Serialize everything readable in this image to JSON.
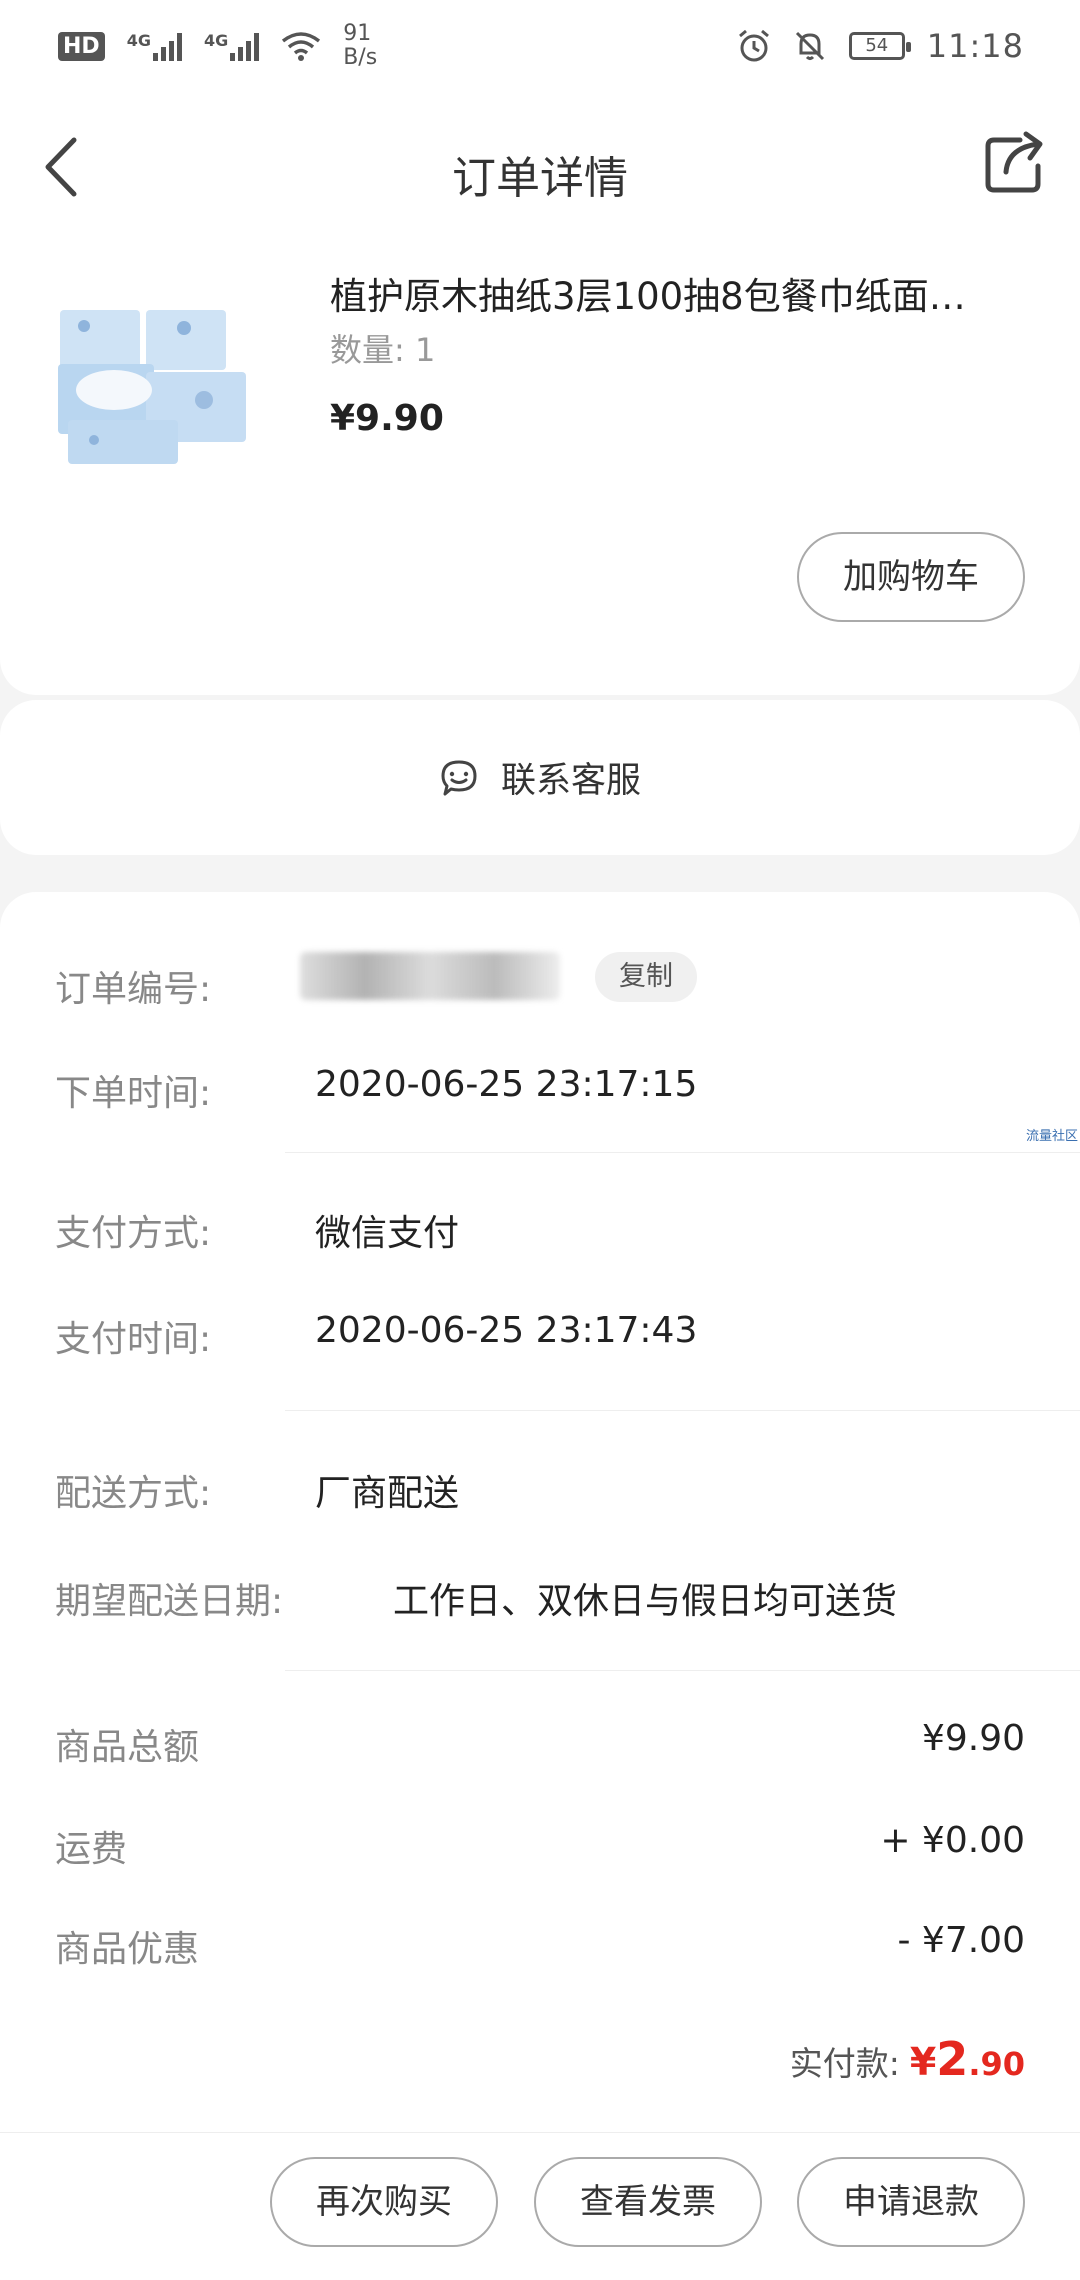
{
  "status_bar": {
    "hd_label": "HD",
    "net_1": "4G",
    "net_2": "4G",
    "speed_value": "91",
    "speed_unit": "B/s",
    "battery": "54",
    "time": "11:18"
  },
  "header": {
    "title": "订单详情"
  },
  "product": {
    "name": "植护原木抽纸3层100抽8包餐巾纸面…",
    "quantity": "数量: 1",
    "price": "¥9.90",
    "add_to_cart": "加购物车"
  },
  "service": {
    "label": "联系客服"
  },
  "order_info": {
    "order_no_label": "订单编号:",
    "copy_label": "复制",
    "order_time_label": "下单时间:",
    "order_time": "2020-06-25 23:17:15",
    "watermark": "流量社区",
    "pay_method_label": "支付方式:",
    "pay_method": "微信支付",
    "pay_time_label": "支付时间:",
    "pay_time": "2020-06-25 23:17:43",
    "delivery_label": "配送方式:",
    "delivery": "厂商配送",
    "expected_date_label": "期望配送日期:",
    "expected_date": "工作日、双休日与假日均可送货"
  },
  "amounts": {
    "goods_total_label": "商品总额",
    "goods_total": "¥9.90",
    "shipping_label": "运费",
    "shipping": "+ ¥0.00",
    "discount_label": "商品优惠",
    "discount": "- ¥7.00",
    "paid_label": "实付款:",
    "paid_symbol": "¥",
    "paid_int": "2",
    "paid_dec": ".90"
  },
  "actions": {
    "buy_again": "再次购买",
    "view_invoice": "查看发票",
    "refund": "申请退款"
  },
  "colors": {
    "accent_red": "#e4281f",
    "background": "#f4f4f4"
  }
}
